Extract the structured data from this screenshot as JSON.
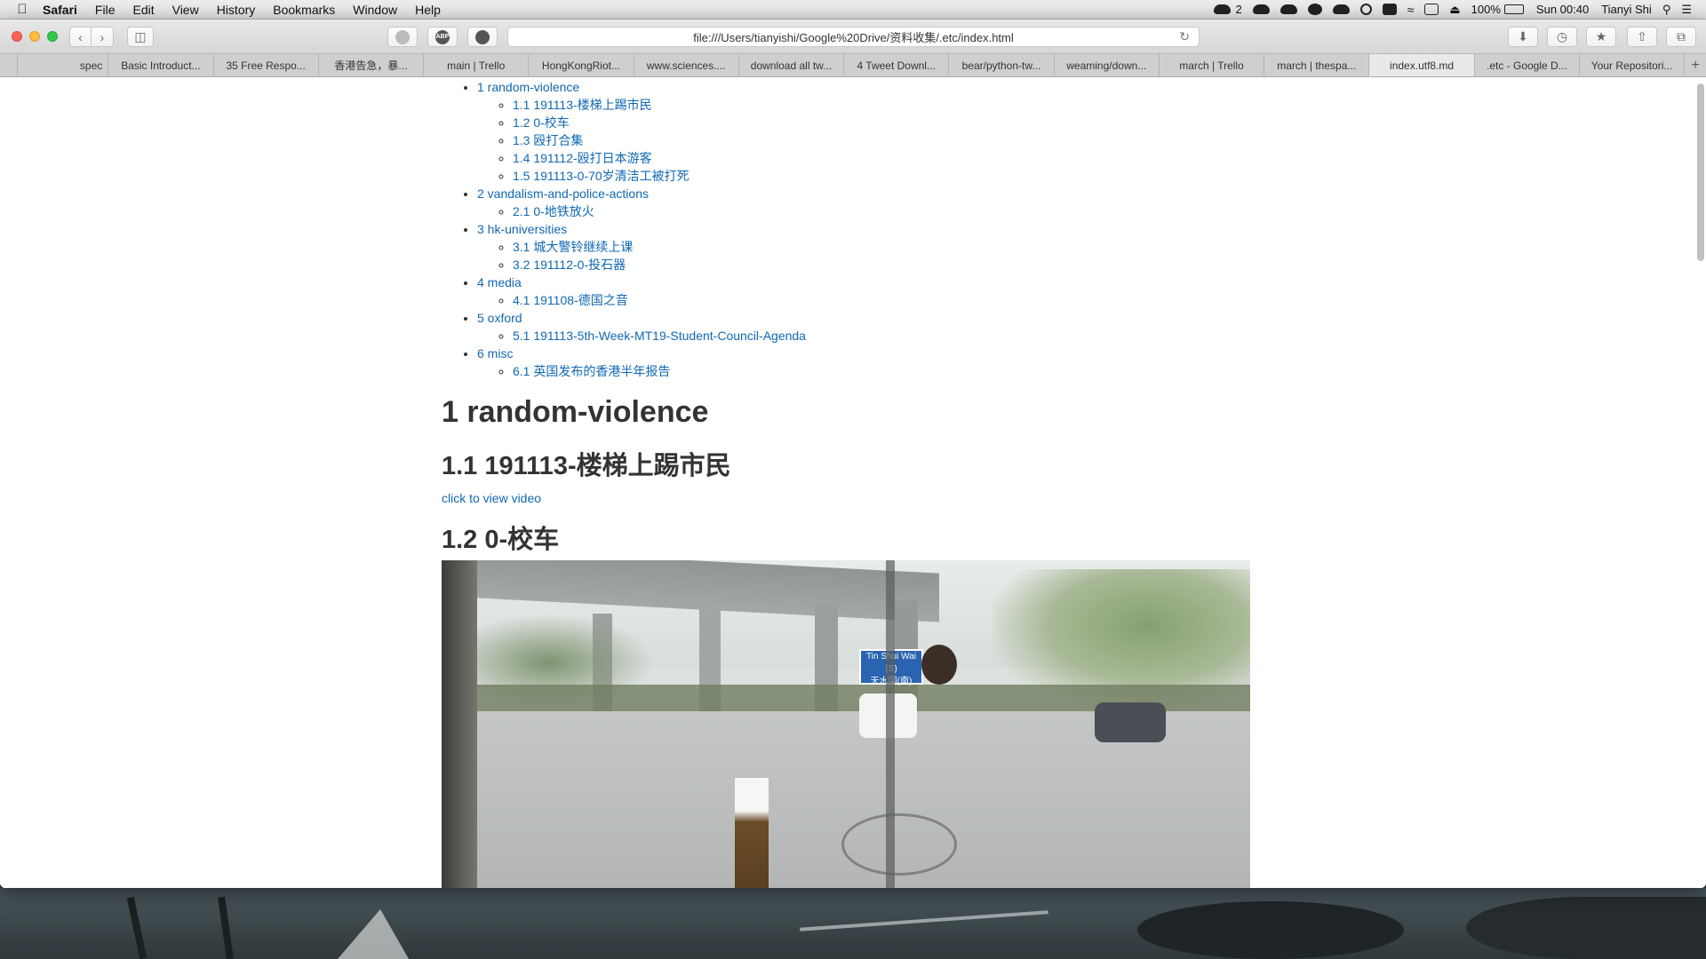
{
  "menubar": {
    "app_name": "Safari",
    "menus": [
      "File",
      "Edit",
      "View",
      "History",
      "Bookmarks",
      "Window",
      "Help"
    ],
    "wechat_count": "2",
    "battery": "100%",
    "clock": "Sun 00:40",
    "user": "Tianyi Shi"
  },
  "browser": {
    "url": "file:///Users/tianyishi/Google%20Drive/资料收集/.etc/index.html",
    "extension_label": "ABP",
    "tabs": [
      "spec",
      "Basic Introduct...",
      "35 Free Respo...",
      "香港告急，暴...",
      "main | Trello",
      "HongKongRiot...",
      "www.sciences....",
      "download all tw...",
      "4 Tweet Downl...",
      "bear/python-tw...",
      "weaming/down...",
      "march | Trello",
      "march | thespa...",
      "index.utf8.md",
      ".etc - Google D...",
      "Your Repositori..."
    ],
    "active_tab_index": 13
  },
  "toc": [
    {
      "label": "1 random-violence",
      "children": [
        "1.1 191113-楼梯上踢市民",
        "1.2 0-校车",
        "1.3 殴打合集",
        "1.4 191112-殴打日本游客",
        "1.5 191113-0-70岁清洁工被打死"
      ]
    },
    {
      "label": "2 vandalism-and-police-actions",
      "children": [
        "2.1 0-地铁放火"
      ]
    },
    {
      "label": "3 hk-universities",
      "children": [
        "3.1 城大警铃继续上课",
        "3.2 191112-0-投石器"
      ]
    },
    {
      "label": "4 media",
      "children": [
        "4.1 191108-德国之音"
      ]
    },
    {
      "label": "5 oxford",
      "children": [
        "5.1 191113-5th-Week-MT19-Student-Council-Agenda"
      ]
    },
    {
      "label": "6 misc",
      "children": [
        "6.1 英国发布的香港半年报告"
      ]
    }
  ],
  "article": {
    "h1": "1 random-violence",
    "h2_first": "1.1 191113-楼梯上踢市民",
    "video_link": "click to view video",
    "h2_second": "1.2 0-校车",
    "photo_sign": "Tin Shui Wai (S)\n天水圍(南)"
  }
}
